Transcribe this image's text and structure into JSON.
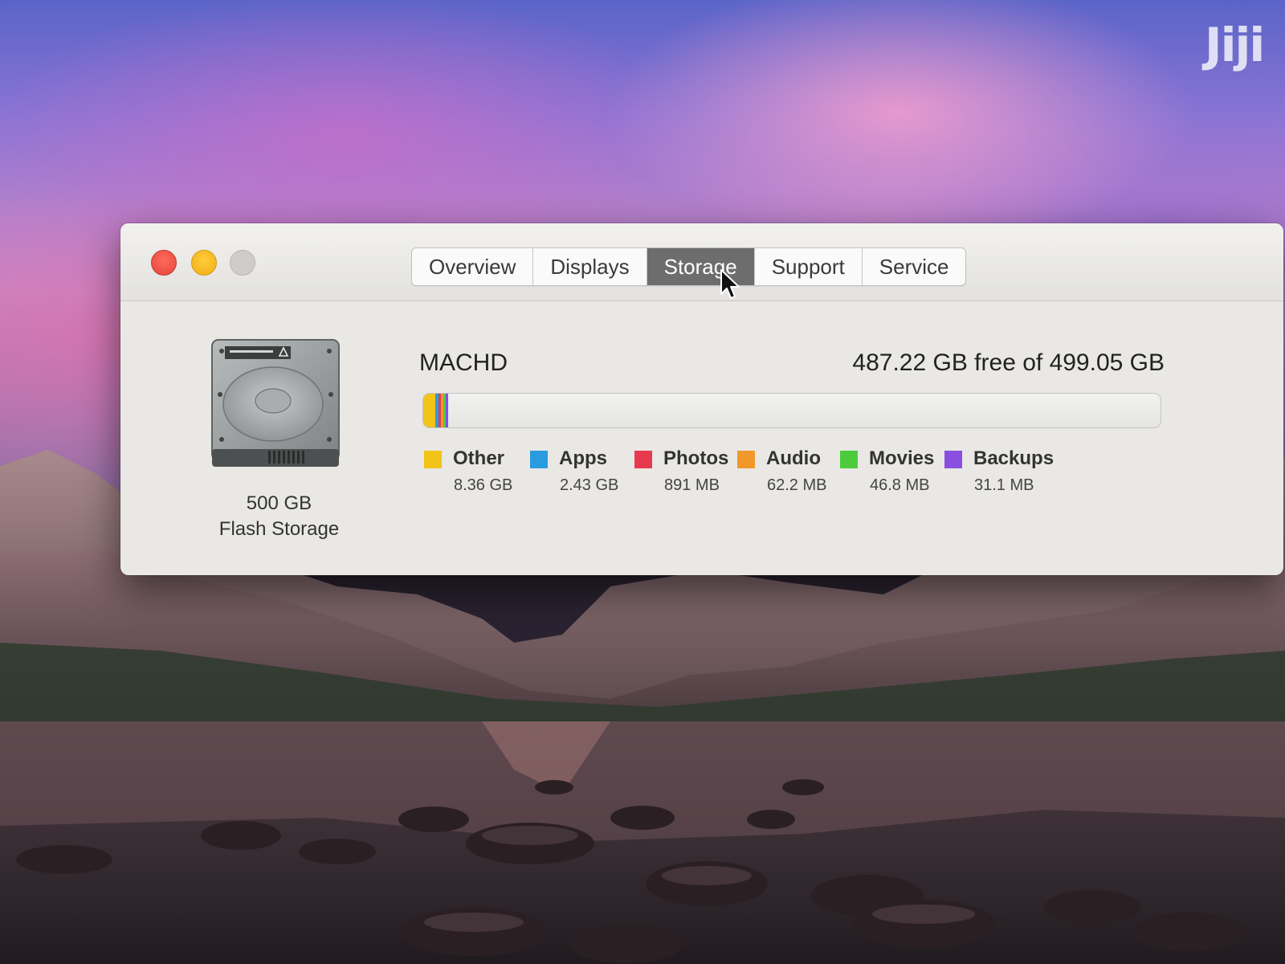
{
  "window": {
    "controls": [
      "close",
      "minimize",
      "zoom"
    ],
    "tabs": [
      {
        "label": "Overview",
        "selected": false
      },
      {
        "label": "Displays",
        "selected": false
      },
      {
        "label": "Storage",
        "selected": true
      },
      {
        "label": "Support",
        "selected": false
      },
      {
        "label": "Service",
        "selected": false
      }
    ]
  },
  "storage": {
    "drive": {
      "capacity": "500 GB",
      "type": "Flash Storage",
      "icon": "hard-drive-icon"
    },
    "volume_name": "MACHD",
    "free_text": "487.22 GB free of 499.05 GB",
    "free_gb": 487.22,
    "total_gb": 499.05,
    "categories": [
      {
        "label": "Other",
        "value": "8.36 GB",
        "gb": 8.36,
        "color": "#f2c418"
      },
      {
        "label": "Apps",
        "value": "2.43 GB",
        "gb": 2.43,
        "color": "#2b9be0"
      },
      {
        "label": "Photos",
        "value": "891 MB",
        "gb": 0.891,
        "color": "#e83a4e"
      },
      {
        "label": "Audio",
        "value": "62.2 MB",
        "gb": 0.0622,
        "color": "#f0982a"
      },
      {
        "label": "Movies",
        "value": "46.8 MB",
        "gb": 0.0468,
        "color": "#4ccc3c"
      },
      {
        "label": "Backups",
        "value": "31.1 MB",
        "gb": 0.0311,
        "color": "#8a4fe0"
      }
    ]
  },
  "watermark": "Jiji"
}
